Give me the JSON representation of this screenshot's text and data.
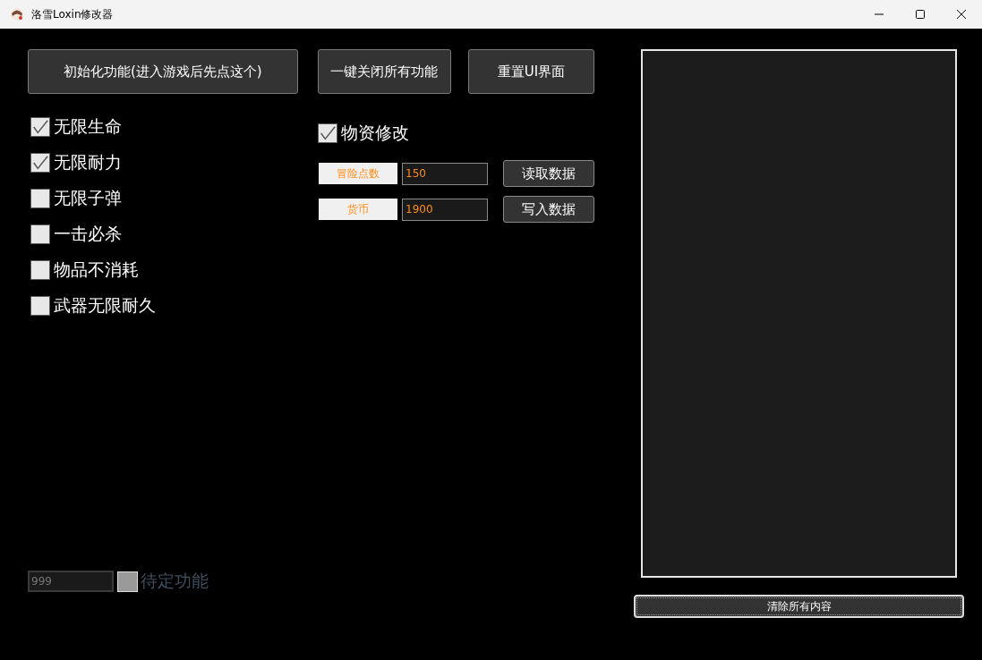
{
  "window": {
    "title": "洛雪Loxin修改器"
  },
  "top_buttons": [
    "初始化功能(进入游戏后先点这个)",
    "一键关闭所有功能",
    "重置UI界面"
  ],
  "cheats": [
    {
      "label": "无限生命",
      "checked": true
    },
    {
      "label": "无限耐力",
      "checked": true
    },
    {
      "label": "无限子弹",
      "checked": false
    },
    {
      "label": "一击必杀",
      "checked": false
    },
    {
      "label": "物品不消耗",
      "checked": false
    },
    {
      "label": "武器无限耐久",
      "checked": false
    }
  ],
  "resources": {
    "label": "物资修改",
    "checked": true,
    "fields": [
      {
        "label": "冒险点数",
        "value": "150"
      },
      {
        "label": "货币",
        "value": "1900"
      }
    ],
    "buttons": [
      "读取数据",
      "写入数据"
    ]
  },
  "pending": {
    "value": "999",
    "label": "待定功能",
    "checked": false,
    "disabled": true
  },
  "clear_button": "清除所有内容"
}
